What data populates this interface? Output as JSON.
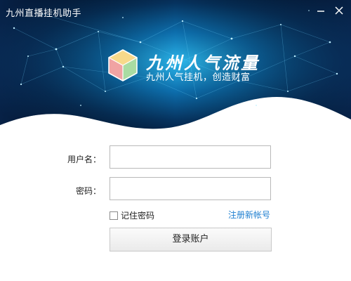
{
  "window": {
    "title": "九州直播挂机助手"
  },
  "brand": {
    "name": "九州人气流量",
    "slogan": "九州人气挂机，创造财富"
  },
  "form": {
    "username_label": "用户名：",
    "username_value": "",
    "password_label": "密码：",
    "password_value": "",
    "remember_label": "记住密码",
    "remember_checked": false,
    "register_link": "注册新帐号",
    "login_button": "登录账户"
  },
  "colors": {
    "header_dark": "#031a3a",
    "header_light": "#1aa0d8",
    "link": "#1e7fd0"
  },
  "icons": {
    "minimize": "minimize-icon",
    "close": "close-icon",
    "logo": "cube-logo-icon"
  }
}
